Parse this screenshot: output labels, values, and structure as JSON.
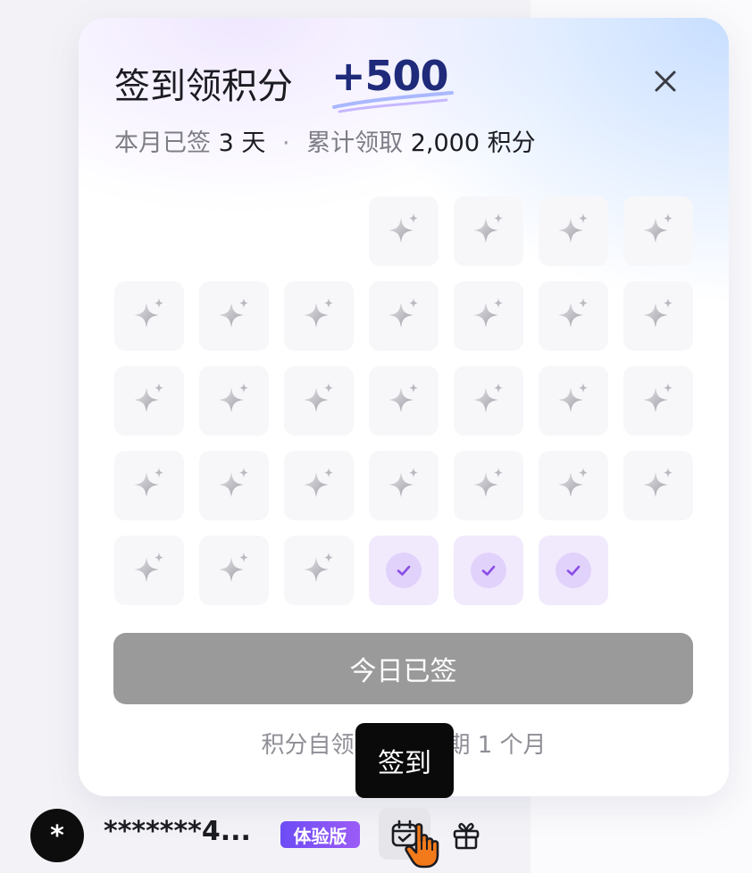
{
  "panel": {
    "title": "签到领积分",
    "bonus": "+500",
    "subtitle": {
      "prefix": "本月已签",
      "days": "3 天",
      "separator": "·",
      "total_label": "累计领取",
      "total_value": "2,000 积分"
    },
    "calendar": {
      "leading_blank_cells": 3,
      "days_in_month": 31,
      "signed_days": [
        29,
        30,
        31
      ],
      "reward_icon": "sparkle-star-icon",
      "signed_icon": "check-circle-icon"
    },
    "signed_button_label": "今日已签",
    "note": "积分自领取后有效期 1 个月"
  },
  "tooltip": {
    "label": "签到"
  },
  "footer": {
    "avatar_text": "*",
    "username": "*******4...",
    "badge": "体验版",
    "calendar_button_icon": "calendar-check-icon",
    "gift_button_icon": "gift-icon"
  },
  "colors": {
    "bonus": "#1f2a7a",
    "badge_start": "#6d4cf5",
    "badge_end": "#9b5cf7",
    "signed_cell": "#f1eafd",
    "check": "#8a4de6",
    "button_disabled": "#9a9a9a",
    "cursor": "#f27a1a"
  }
}
